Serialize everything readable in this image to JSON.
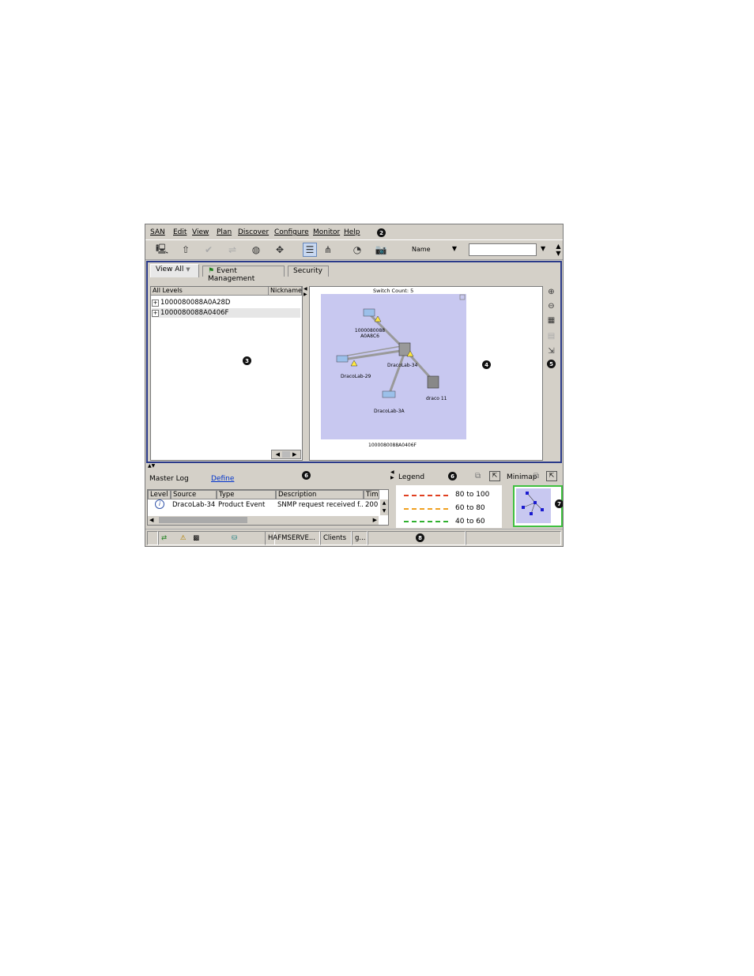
{
  "menu": [
    "SAN",
    "Edit",
    "View",
    "Plan",
    "Discover",
    "Configure",
    "Monitor",
    "Help"
  ],
  "markers": {
    "m2": "2",
    "m3": "3",
    "m4": "4",
    "m5": "5",
    "m6": "6",
    "m7": "7",
    "m8": "8",
    "m9": "9"
  },
  "toolbar": {
    "name_combo": "Name",
    "search_value": ""
  },
  "tabs": [
    "View All",
    "Event Management",
    "Security"
  ],
  "tree": {
    "columns": [
      "All Levels",
      "Nickname"
    ],
    "rows": [
      "1000080088A0A28D",
      "1000080088A0406F"
    ]
  },
  "topology": {
    "switch_count": "Switch Count: 5",
    "fabric_label": "1000080088A0406F",
    "nodes": [
      "1000080088 A0A8C6",
      "DracoLab-34",
      "DracoLab-29",
      "draco 11",
      "DracoLab-3A"
    ]
  },
  "master_log": {
    "title": "Master Log",
    "define": "Define",
    "columns": [
      "Level",
      "Source",
      "Type",
      "Description",
      "Tim"
    ],
    "rows": [
      {
        "source": "DracoLab-34",
        "type": "Product Event",
        "description": "SNMP request received f...",
        "time": "200"
      }
    ]
  },
  "legend": {
    "title": "Legend",
    "items": [
      {
        "label": "80 to 100",
        "color": "#e04020"
      },
      {
        "label": "60 to 80",
        "color": "#f0a020"
      },
      {
        "label": "40 to 60",
        "color": "#30b030"
      }
    ]
  },
  "minimap": {
    "title": "Minimap"
  },
  "status": {
    "server": "HAFMSERVE...",
    "clients": "Clients",
    "g": "g..."
  },
  "colors": {
    "chrome": "#d4d0c8",
    "topology_bg": "#c8c8f0",
    "focus_border": "#2a3a8a",
    "minimap_border": "#40c040"
  }
}
